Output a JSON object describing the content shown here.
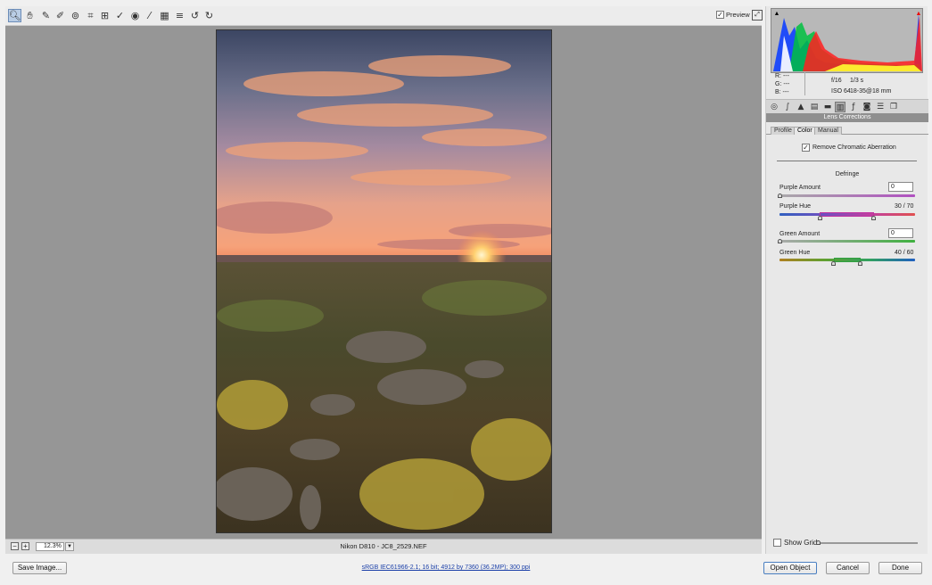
{
  "toolbar": {
    "tools": [
      {
        "name": "zoom-tool",
        "glyph": "🔍︎"
      },
      {
        "name": "hand-tool",
        "glyph": "✋︎"
      },
      {
        "name": "white-balance-tool",
        "glyph": "✎"
      },
      {
        "name": "color-sampler-tool",
        "glyph": "✐"
      },
      {
        "name": "targeted-adjustment-tool",
        "glyph": "⊚"
      },
      {
        "name": "crop-tool",
        "glyph": "⌗"
      },
      {
        "name": "straighten-tool",
        "glyph": "⊞"
      },
      {
        "name": "spot-removal-tool",
        "glyph": "✓"
      },
      {
        "name": "red-eye-tool",
        "glyph": "◉"
      },
      {
        "name": "adjustment-brush-tool",
        "glyph": "⁄"
      },
      {
        "name": "graduated-filter-tool",
        "glyph": "▦"
      },
      {
        "name": "preferences-tool",
        "glyph": "≡"
      },
      {
        "name": "rotate-left-tool",
        "glyph": "↺"
      },
      {
        "name": "rotate-right-tool",
        "glyph": "↻"
      }
    ],
    "preview_label": "Preview",
    "preview_checked": "✓"
  },
  "status": {
    "zoom": "12.3%",
    "filename": "Nikon D810   -  JC8_2529.NEF"
  },
  "panel": {
    "rgb": {
      "r": "R:   ---",
      "g": "G:   ---",
      "b": "B:   ---"
    },
    "exposure": {
      "aperture": "f/16",
      "shutter": "1/3 s",
      "iso": "ISO 64",
      "lens": "18-35@18 mm"
    },
    "section_title": "Lens Corrections",
    "tabs": [
      "Profile",
      "Color",
      "Manual"
    ],
    "remove_ca_label": "Remove Chromatic Aberration",
    "remove_ca_checked": "✓",
    "defringe_title": "Defringe",
    "purple_amount_label": "Purple Amount",
    "purple_amount_value": "0",
    "purple_hue_label": "Purple Hue",
    "purple_hue_value": "30 / 70",
    "green_amount_label": "Green Amount",
    "green_amount_value": "0",
    "green_hue_label": "Green Hue",
    "green_hue_value": "40 / 60",
    "show_grid_label": "Show Grid"
  },
  "footer": {
    "save_label": "Save Image...",
    "workflow_link": "sRGB IEC61966-2.1; 16 bit; 4912 by 7360 (36.2MP); 300 ppi",
    "open_label": "Open Object",
    "cancel_label": "Cancel",
    "done_label": "Done"
  },
  "colors": {
    "accent": "#4a7fc1",
    "canvas_bg": "#969696",
    "panel_header": "#8f8f8f"
  }
}
